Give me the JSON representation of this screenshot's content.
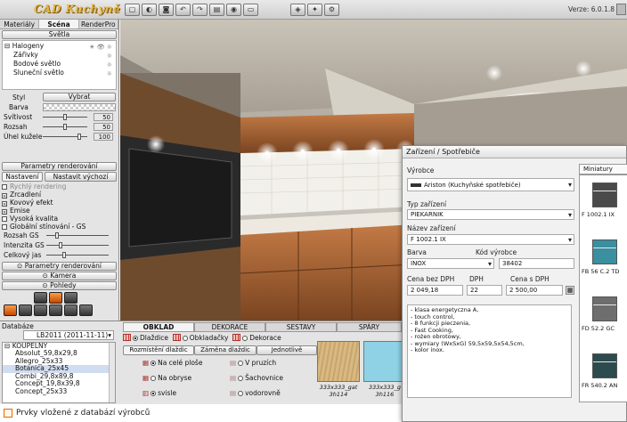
{
  "app": {
    "logo": "CAD Kuchyně",
    "version": "Verze: 6.0.1.8"
  },
  "left": {
    "tabs": [
      "Materiály",
      "Scéna",
      "RenderPro"
    ],
    "lighting_header": "Světla",
    "lights": [
      {
        "label": "Halogeny",
        "icons": "☀ 👁 ☼"
      },
      {
        "label": "Zářivky",
        "icons": "☼"
      },
      {
        "label": "Bodové světlo",
        "icons": "☼"
      },
      {
        "label": "Sluneční světlo",
        "icons": "☼"
      }
    ],
    "style_label": "Styl",
    "select_label": "Vybrat",
    "color_label": "Barva",
    "props": [
      {
        "label": "Svítivost",
        "value": "50",
        "level": 0.5
      },
      {
        "label": "Rozsah",
        "value": "50",
        "level": 0.5
      },
      {
        "label": "Úhel kužele",
        "value": "100",
        "level": 0.85
      }
    ],
    "render_params": "Parametry renderování",
    "settings_tab": "Nastavení",
    "default_button": "Nastavit výchozí",
    "checks": [
      {
        "label": "Rychlý rendering",
        "checked": false,
        "dim": true
      },
      {
        "label": "Zrcadlení",
        "checked": true
      },
      {
        "label": "Kovový efekt",
        "checked": true
      },
      {
        "label": "Emise",
        "checked": true
      },
      {
        "label": "Vysoká kvalita",
        "checked": false
      },
      {
        "label": "Globální stínování - GS",
        "checked": false
      }
    ],
    "gs_props": [
      "Rozsah GS",
      "Intenzita GS",
      "Celkový jas"
    ],
    "render_params2": "Parametry renderování",
    "camera": "Kamera",
    "views": "Pohledy"
  },
  "bottom": {
    "db_label": "Databáze",
    "db_value": "LB2011 (2011-11-11)",
    "tabs": [
      "OBKLAD",
      "DEKORACE",
      "SESTAVY",
      "SPÁRY"
    ],
    "radios": [
      "Dlaždice",
      "Obkladačky",
      "Dekorace"
    ],
    "subtabs": [
      "Rozmístění dlaždic",
      "Záměna dlaždic",
      "Jednotlivě"
    ],
    "tree_root": "KOUPELNY",
    "tree_items": [
      "Absolut_59,8x29,8",
      "Allegro_25x33",
      "Botanica_25x45",
      "Combi_29,8x89,8",
      "Concept_19,8x39,8",
      "Concept_25x33"
    ],
    "options_left": [
      "Na celé ploše",
      "Na obryse",
      "svisle"
    ],
    "options_right": [
      "V pruzích",
      "Šachovnice",
      "vodorovně"
    ],
    "thumbs": [
      {
        "label": "333x333_gat\n3h114",
        "color": "#d7b57e"
      },
      {
        "label": "333x333_g\n3h116",
        "color": "#8fd2e6"
      }
    ]
  },
  "status": "Prvky vložené z databází výrobců",
  "dialog": {
    "title": "Zařízení / Spotřebiče",
    "manufacturer_label": "Výrobce",
    "manufacturer": "Ariston (Kuchyňské spotřebiče)",
    "type_label": "Typ zařízení",
    "type": "PIEKARNIK",
    "name_label": "Název zařízení",
    "name": "F 1002.1 IX",
    "color_label": "Barva",
    "color": "INOX",
    "code_label": "Kód výrobce",
    "code": "38402",
    "price_ex_label": "Cena bez DPH",
    "price_ex": "2 049,18",
    "vat_label": "DPH",
    "vat": "22",
    "price_in_label": "Cena s DPH",
    "price_in": "2 500,00",
    "description": "- klasa energetyczna A,\n- touch control,\n- 8 funkcji pieczenia,\n- Fast Cooking,\n- rożen obrotowy,\n- wymiary (WxSxG) 59,5x59,5x54,5cm,\n- kolor inox.",
    "mini_tab": "Miniatury",
    "minis": [
      {
        "label": "F 1002.1 IX",
        "color": "#4a4a4a"
      },
      {
        "label": "FB 56 C.2 TD",
        "color": "#3a8fa0"
      },
      {
        "label": "FD 52.2 GC",
        "color": "#6e6e6e"
      },
      {
        "label": "FR 540.2 AN",
        "color": "#2b4b4e"
      }
    ]
  }
}
